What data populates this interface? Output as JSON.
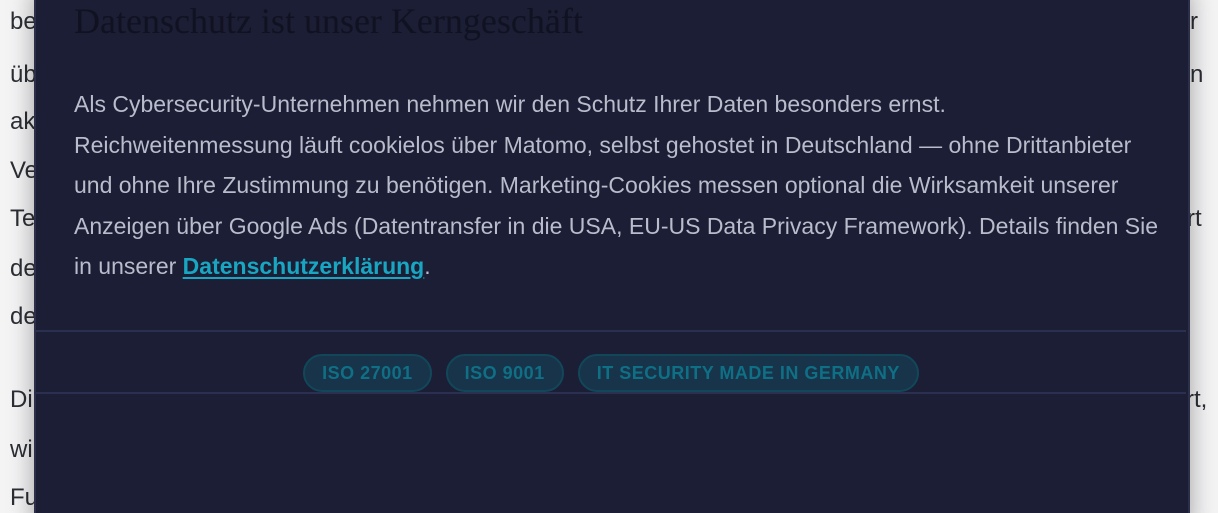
{
  "background": {
    "left_fragments": [
      "be",
      "üb",
      "ak",
      "Ve",
      "Te",
      "de",
      "de",
      "Di",
      "wi",
      "Fu"
    ],
    "right_fragments": [
      "r",
      "n",
      "rt",
      "rt,"
    ]
  },
  "consent_modal": {
    "title": "Datenschutz ist unser Kerngeschäft",
    "body_text": "Als Cybersecurity-Unternehmen nehmen wir den Schutz Ihrer Daten besonders ernst. Reichweitenmessung läuft cookielos über Matomo, selbst gehostet in Deutschland — ohne Drittanbieter und ohne Ihre Zustimmung zu benötigen. Marketing-Cookies messen optional die Wirksamkeit unserer Anzeigen über Google Ads (Datentransfer in die USA, EU-US Data Privacy Framework). Details finden Sie in unserer ",
    "privacy_link": "Datenschutzerklärung",
    "body_end": ".",
    "badges": [
      "ISO 27001",
      "ISO 9001",
      "IT SECURITY MADE IN GERMANY"
    ]
  },
  "colors": {
    "modal_background": "#1b1e34",
    "link": "#19a6c2",
    "badge_text": "#0f6f85"
  }
}
